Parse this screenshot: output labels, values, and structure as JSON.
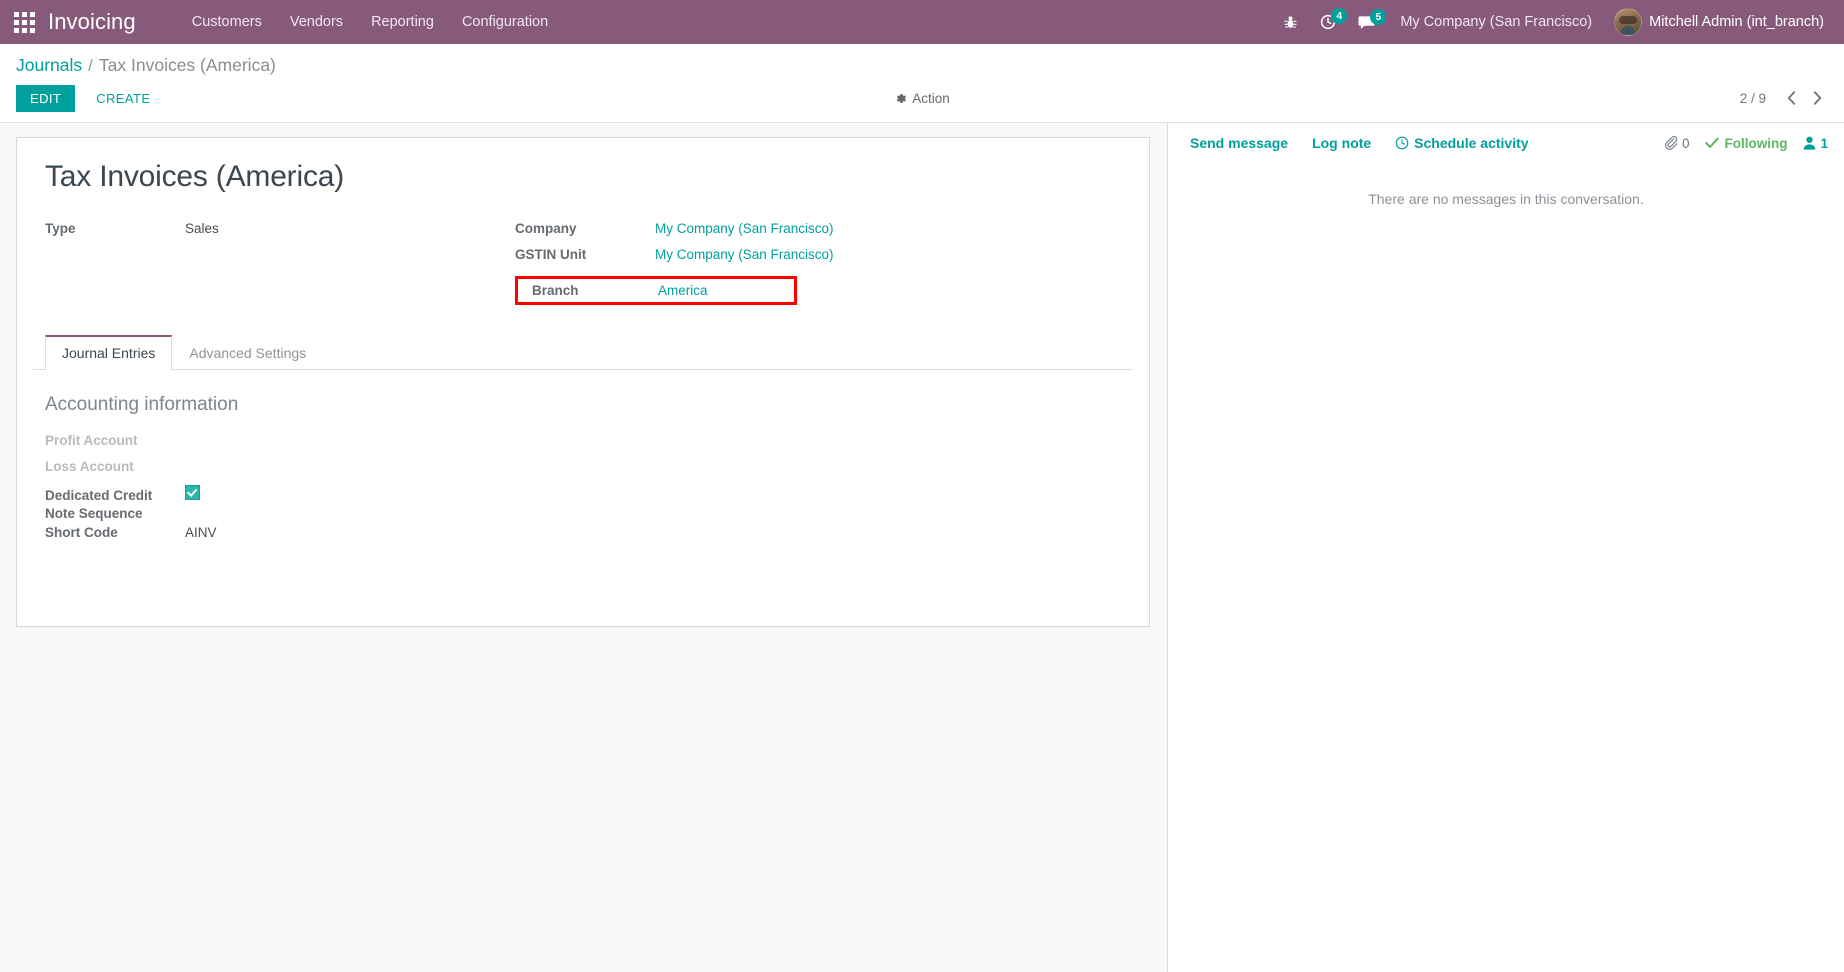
{
  "navbar": {
    "apps_icon": "apps-grid-icon",
    "brand": "Invoicing",
    "menu": [
      {
        "label": "Customers"
      },
      {
        "label": "Vendors"
      },
      {
        "label": "Reporting"
      },
      {
        "label": "Configuration"
      }
    ],
    "debug_icon": "bug-icon",
    "activities": {
      "icon": "clock-icon",
      "count": "4"
    },
    "messages": {
      "icon": "comment-icon",
      "count": "5"
    },
    "company": "My Company (San Francisco)",
    "user": "Mitchell Admin (int_branch)",
    "avatar_icon": "user-avatar",
    "brand_color": "#875A7B",
    "badge_color": "#00A09D"
  },
  "control_panel": {
    "breadcrumb": {
      "root": "Journals",
      "separator": "/",
      "current": "Tax Invoices (America)"
    },
    "edit_label": "EDIT",
    "create_label": "CREATE",
    "action_label": "Action",
    "action_icon": "gear-icon",
    "pager": {
      "value": "2 / 9",
      "prev_icon": "chevron-left-icon",
      "next_icon": "chevron-right-icon"
    },
    "accent_color": "#00A09D"
  },
  "form": {
    "title": "Tax Invoices (America)",
    "left_fields": [
      {
        "label": "Type",
        "value": "Sales",
        "is_link": false
      }
    ],
    "right_fields": [
      {
        "label": "Company",
        "value": "My Company (San Francisco)",
        "is_link": true
      },
      {
        "label": "GSTIN Unit",
        "value": "My Company (San Francisco)",
        "is_link": true
      }
    ],
    "highlighted_field": {
      "label": "Branch",
      "value": "America",
      "highlight_color": "#ff0000"
    },
    "tabs": [
      {
        "label": "Journal Entries",
        "active": true
      },
      {
        "label": "Advanced Settings",
        "active": false
      }
    ],
    "accounting_section": {
      "title": "Accounting information",
      "rows": [
        {
          "label": "Profit Account",
          "value": "",
          "muted": true,
          "type": "text"
        },
        {
          "label": "Loss Account",
          "value": "",
          "muted": true,
          "type": "text"
        },
        {
          "label": "Dedicated Credit Note Sequence",
          "value": "",
          "muted": false,
          "type": "checkbox",
          "checked": true
        },
        {
          "label": "Short Code",
          "value": "AINV",
          "muted": false,
          "type": "text"
        }
      ]
    }
  },
  "chatter": {
    "send_message": "Send message",
    "log_note": "Log note",
    "schedule_activity": "Schedule activity",
    "schedule_icon": "clock-icon",
    "attachment_icon": "paperclip-icon",
    "attachment_count": "0",
    "following_icon": "check-icon",
    "following_label": "Following",
    "follower_icon": "user-icon",
    "follower_count": "1",
    "empty_message": "There are no messages in this conversation."
  }
}
